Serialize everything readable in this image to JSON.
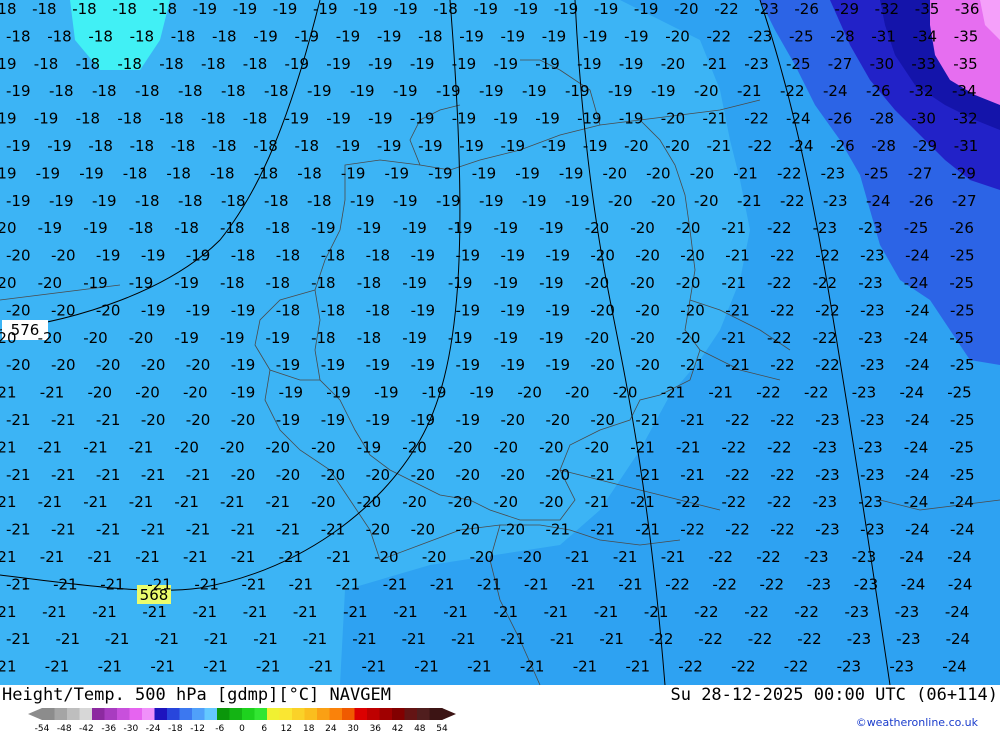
{
  "title": "Height/Temp. 500 hPa [gdmp][°C] NAVGEM",
  "valid_time": "Su 28-12-2025 00:00 UTC (06+114)",
  "credit": "©weatheronline.co.uk",
  "legend": {
    "ticks": [
      "-54",
      "-48",
      "-42",
      "-36",
      "-30",
      "-24",
      "-18",
      "-12",
      "-6",
      "0",
      "6",
      "12",
      "18",
      "24",
      "30",
      "36",
      "42",
      "48",
      "54"
    ],
    "colors": [
      "#8c8c8c",
      "#a5a5a5",
      "#bebebe",
      "#d7d7d7",
      "#8c2aa0",
      "#a83cc0",
      "#c850dc",
      "#e664f0",
      "#f090fa",
      "#1e14be",
      "#2846dc",
      "#3c78f0",
      "#50a0fa",
      "#64c8ff",
      "#0a960a",
      "#14b414",
      "#1ed21e",
      "#32e632",
      "#f0f032",
      "#fae632",
      "#fad228",
      "#fabe1e",
      "#faa014",
      "#fa820a",
      "#f05a00",
      "#dc0000",
      "#be0000",
      "#a00000",
      "#820000",
      "#641414",
      "#501e1e",
      "#3c1414"
    ]
  },
  "contours": [
    {
      "label": "576"
    },
    {
      "label": "568"
    }
  ],
  "temperature_rows": [
    [
      "-18",
      "-18",
      "-18",
      "-18",
      "-18",
      "-19",
      "-19",
      "-19",
      "-19",
      "-19",
      "-19",
      "-18",
      "-19",
      "-19",
      "-19",
      "-19",
      "-19",
      "-20",
      "-22",
      "-23",
      "-26",
      "-29",
      "-32",
      "-35",
      "-36"
    ],
    [
      "-18",
      "-18",
      "-18",
      "-18",
      "-18",
      "-18",
      "-19",
      "-19",
      "-19",
      "-19",
      "-18",
      "-19",
      "-19",
      "-19",
      "-19",
      "-19",
      "-20",
      "-22",
      "-23",
      "-25",
      "-28",
      "-31",
      "-34",
      "-35"
    ],
    [
      "-19",
      "-18",
      "-18",
      "-18",
      "-18",
      "-18",
      "-18",
      "-19",
      "-19",
      "-19",
      "-19",
      "-19",
      "-19",
      "-19",
      "-19",
      "-19",
      "-20",
      "-21",
      "-23",
      "-25",
      "-27",
      "-30",
      "-33",
      "-35"
    ],
    [
      "-19",
      "-18",
      "-18",
      "-18",
      "-18",
      "-18",
      "-18",
      "-19",
      "-19",
      "-19",
      "-19",
      "-19",
      "-19",
      "-19",
      "-19",
      "-19",
      "-20",
      "-21",
      "-22",
      "-24",
      "-26",
      "-32",
      "-34"
    ],
    [
      "-19",
      "-19",
      "-18",
      "-18",
      "-18",
      "-18",
      "-18",
      "-19",
      "-19",
      "-19",
      "-19",
      "-19",
      "-19",
      "-19",
      "-19",
      "-19",
      "-20",
      "-21",
      "-22",
      "-24",
      "-26",
      "-28",
      "-30",
      "-32"
    ],
    [
      "-19",
      "-19",
      "-18",
      "-18",
      "-18",
      "-18",
      "-18",
      "-18",
      "-19",
      "-19",
      "-19",
      "-19",
      "-19",
      "-19",
      "-19",
      "-20",
      "-20",
      "-21",
      "-22",
      "-24",
      "-26",
      "-28",
      "-29",
      "-31"
    ],
    [
      "-19",
      "-19",
      "-19",
      "-18",
      "-18",
      "-18",
      "-18",
      "-18",
      "-19",
      "-19",
      "-19",
      "-19",
      "-19",
      "-19",
      "-20",
      "-20",
      "-20",
      "-21",
      "-22",
      "-23",
      "-25",
      "-27",
      "-29"
    ],
    [
      "-19",
      "-19",
      "-19",
      "-18",
      "-18",
      "-18",
      "-18",
      "-18",
      "-19",
      "-19",
      "-19",
      "-19",
      "-19",
      "-19",
      "-20",
      "-20",
      "-20",
      "-21",
      "-22",
      "-23",
      "-24",
      "-26",
      "-27"
    ],
    [
      "-20",
      "-19",
      "-19",
      "-18",
      "-18",
      "-18",
      "-18",
      "-19",
      "-19",
      "-19",
      "-19",
      "-19",
      "-19",
      "-20",
      "-20",
      "-20",
      "-21",
      "-22",
      "-23",
      "-23",
      "-25",
      "-26"
    ],
    [
      "-20",
      "-20",
      "-19",
      "-19",
      "-19",
      "-18",
      "-18",
      "-18",
      "-18",
      "-19",
      "-19",
      "-19",
      "-19",
      "-20",
      "-20",
      "-20",
      "-21",
      "-22",
      "-22",
      "-23",
      "-24",
      "-25"
    ],
    [
      "-20",
      "-20",
      "-19",
      "-19",
      "-19",
      "-18",
      "-18",
      "-18",
      "-18",
      "-19",
      "-19",
      "-19",
      "-19",
      "-20",
      "-20",
      "-20",
      "-21",
      "-22",
      "-22",
      "-23",
      "-24",
      "-25"
    ],
    [
      "-20",
      "-20",
      "-20",
      "-19",
      "-19",
      "-19",
      "-18",
      "-18",
      "-18",
      "-19",
      "-19",
      "-19",
      "-19",
      "-20",
      "-20",
      "-20",
      "-21",
      "-22",
      "-22",
      "-23",
      "-24",
      "-25"
    ],
    [
      "-20",
      "-20",
      "-20",
      "-20",
      "-19",
      "-19",
      "-19",
      "-18",
      "-18",
      "-19",
      "-19",
      "-19",
      "-19",
      "-20",
      "-20",
      "-20",
      "-21",
      "-22",
      "-22",
      "-23",
      "-24",
      "-25"
    ],
    [
      "-20",
      "-20",
      "-20",
      "-20",
      "-20",
      "-19",
      "-19",
      "-19",
      "-19",
      "-19",
      "-19",
      "-19",
      "-19",
      "-20",
      "-20",
      "-21",
      "-21",
      "-22",
      "-22",
      "-23",
      "-24",
      "-25"
    ],
    [
      "-21",
      "-21",
      "-20",
      "-20",
      "-20",
      "-19",
      "-19",
      "-19",
      "-19",
      "-19",
      "-19",
      "-20",
      "-20",
      "-20",
      "-21",
      "-21",
      "-22",
      "-22",
      "-23",
      "-24",
      "-25"
    ],
    [
      "-21",
      "-21",
      "-21",
      "-20",
      "-20",
      "-20",
      "-19",
      "-19",
      "-19",
      "-19",
      "-19",
      "-20",
      "-20",
      "-20",
      "-21",
      "-21",
      "-22",
      "-22",
      "-23",
      "-23",
      "-24",
      "-25"
    ],
    [
      "-21",
      "-21",
      "-21",
      "-21",
      "-20",
      "-20",
      "-20",
      "-20",
      "-19",
      "-20",
      "-20",
      "-20",
      "-20",
      "-20",
      "-21",
      "-21",
      "-22",
      "-22",
      "-23",
      "-23",
      "-24",
      "-25"
    ],
    [
      "-21",
      "-21",
      "-21",
      "-21",
      "-21",
      "-20",
      "-20",
      "-20",
      "-20",
      "-20",
      "-20",
      "-20",
      "-20",
      "-21",
      "-21",
      "-21",
      "-22",
      "-22",
      "-23",
      "-23",
      "-24",
      "-25"
    ],
    [
      "-21",
      "-21",
      "-21",
      "-21",
      "-21",
      "-21",
      "-21",
      "-20",
      "-20",
      "-20",
      "-20",
      "-20",
      "-20",
      "-21",
      "-21",
      "-22",
      "-22",
      "-22",
      "-23",
      "-23",
      "-24",
      "-24"
    ],
    [
      "-21",
      "-21",
      "-21",
      "-21",
      "-21",
      "-21",
      "-21",
      "-21",
      "-20",
      "-20",
      "-20",
      "-20",
      "-21",
      "-21",
      "-21",
      "-22",
      "-22",
      "-22",
      "-23",
      "-23",
      "-24",
      "-24"
    ],
    [
      "-21",
      "-21",
      "-21",
      "-21",
      "-21",
      "-21",
      "-21",
      "-21",
      "-20",
      "-20",
      "-20",
      "-20",
      "-21",
      "-21",
      "-21",
      "-22",
      "-22",
      "-23",
      "-23",
      "-24",
      "-24"
    ],
    [
      "-21",
      "-21",
      "-21",
      "-21",
      "-21",
      "-21",
      "-21",
      "-21",
      "-21",
      "-21",
      "-21",
      "-21",
      "-21",
      "-21",
      "-22",
      "-22",
      "-22",
      "-23",
      "-23",
      "-24",
      "-24"
    ],
    [
      "-21",
      "-21",
      "-21",
      "-21",
      "-21",
      "-21",
      "-21",
      "-21",
      "-21",
      "-21",
      "-21",
      "-21",
      "-21",
      "-21",
      "-22",
      "-22",
      "-22",
      "-23",
      "-23",
      "-24"
    ],
    [
      "-21",
      "-21",
      "-21",
      "-21",
      "-21",
      "-21",
      "-21",
      "-21",
      "-21",
      "-21",
      "-21",
      "-21",
      "-21",
      "-22",
      "-22",
      "-22",
      "-22",
      "-23",
      "-23",
      "-24"
    ],
    [
      "-21",
      "-21",
      "-21",
      "-21",
      "-21",
      "-21",
      "-21",
      "-21",
      "-21",
      "-21",
      "-21",
      "-21",
      "-21",
      "-22",
      "-22",
      "-22",
      "-23",
      "-23",
      "-24"
    ],
    [
      "-21",
      "-21",
      "-21",
      "-21",
      "-21",
      "-21",
      "-21",
      "-21",
      "-21",
      "-21",
      "-22",
      "-22",
      "-22",
      "-22",
      "-22",
      "-22",
      "-23",
      "-23",
      "-24"
    ]
  ]
}
